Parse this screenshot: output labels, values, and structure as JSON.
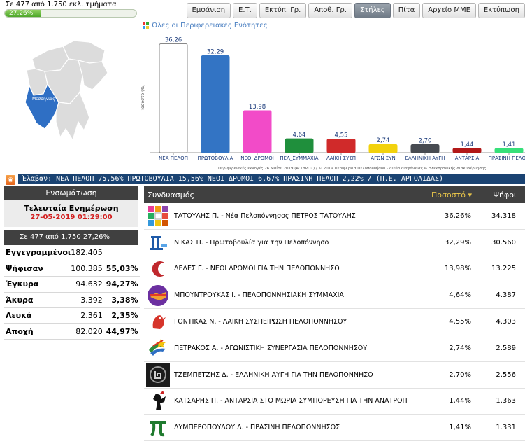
{
  "header": {
    "count_text": "Σε 477 από 1.750 εκλ. τμήματα",
    "progress_label": "27,26%",
    "progress_fraction": 0.2726
  },
  "toolbar": {
    "buttons": [
      {
        "label": "Εμφάνιση",
        "active": false
      },
      {
        "label": "Ε.Τ.",
        "active": false
      },
      {
        "label": "Εκτύπ. Γρ.",
        "active": false
      },
      {
        "label": "Αποθ. Γρ.",
        "active": false
      },
      {
        "label": "Στήλες",
        "active": true
      },
      {
        "label": "Πίτα",
        "active": false
      },
      {
        "label": "Αρχείο ΜΜΕ",
        "active": false
      },
      {
        "label": "Εκτύπωση",
        "active": false
      }
    ]
  },
  "map": {
    "selected_label": "Μεσσηνίας",
    "base_color": "#dcdcdc",
    "selected_color": "#2f6fc4"
  },
  "chart_title": "Όλες οι Περιφερειακές Ενότητες",
  "chart_footer": "Περιφερειακές εκλογές 26 Μαΐου 2019 (Α' ΓΥΡΟΣ) / © 2019 Περιφέρεια Πελοποννήσου - Διεύθ Διαφάνειας & Ηλεκτρονικής Διακυβέρνησης",
  "chart_data": {
    "type": "bar",
    "ylabel": "Ποσοστό (%)",
    "categories": [
      "ΝΕΑ ΠΕΛΟΠ",
      "ΠΡΩΤΟΒΟΥΛΙΑ",
      "ΝΕΟΙ ΔΡΟΜΟΙ",
      "ΠΕΛ_ΣΥΜΜΑΧΙΑ",
      "ΛΑΪΚΗ ΣΥΣΠ",
      "ΑΓΩΝ ΣΥΝ",
      "ΕΛΛΗΝΙΚΗ ΑΥΓΗ",
      "ΑΝΤΑΡΣΙΑ",
      "ΠΡΑΣΙΝΗ ΠΕΛΟΠ"
    ],
    "values": [
      36.26,
      32.29,
      13.98,
      4.64,
      4.55,
      2.74,
      2.7,
      1.44,
      1.41
    ],
    "value_labels": [
      "36,26",
      "32,29",
      "13,98",
      "4,64",
      "4,55",
      "2,74",
      "2,70",
      "1,44",
      "1,41"
    ],
    "colors": [
      "#ffffff",
      "#3374c4",
      "#f24bc8",
      "#1f8f3c",
      "#d02a2a",
      "#f2d20e",
      "#474b52",
      "#b21818",
      "#37e07a"
    ],
    "ylim": [
      0,
      38
    ]
  },
  "ticker": {
    "text": "Έλαβαν: ΝΕΑ ΠΕΛΟΠ 75,56%  ΠΡΩΤΟΒΟΥΛΙΑ 15,56%  ΝΕΟΙ ΔΡΟΜΟΙ 6,67%  ΠΡΑΣΙΝΗ ΠΕΛΟΠ 2,22%  /  (Π.Ε. ΑΡΓΟΛΙΔΑΣ)"
  },
  "left_panel": {
    "header": "Ενσωμάτωση",
    "update_title": "Τελευταία Ενημέρωση",
    "update_date": "27-05-2019 01:29:00",
    "count_text": "Σε 477  από  1.750   27,26%",
    "rows": [
      {
        "label": "Εγγεγραμμένοι",
        "value": "182.405",
        "pct": ""
      },
      {
        "label": "Ψήφισαν",
        "value": "100.385",
        "pct": "55,03%"
      },
      {
        "label": "Έγκυρα",
        "value": "94.632",
        "pct": "94,27%"
      },
      {
        "label": "Άκυρα",
        "value": "3.392",
        "pct": "3,38%"
      },
      {
        "label": "Λευκά",
        "value": "2.361",
        "pct": "2,35%"
      },
      {
        "label": "Αποχή",
        "value": "82.020",
        "pct": "44,97%"
      }
    ]
  },
  "results": {
    "header_name": "Συνδυασμός",
    "header_pct": "Ποσοστό",
    "header_votes": "Ψήφοι",
    "rows": [
      {
        "name": "ΤΑΤΟΥΛΗΣ Π. - Νέα Πελοπόννησος ΠΕΤΡΟΣ ΤΑΤΟΥΛΗΣ",
        "pct": "36,26%",
        "votes": "34.318",
        "logo": "tiles-logo"
      },
      {
        "name": "ΝΙΚΑΣ Π. - Πρωτοβουλία για την Πελοπόννησο",
        "pct": "32,29%",
        "votes": "30.560",
        "logo": "column-logo"
      },
      {
        "name": "ΔΕΔΕΣ Γ. - ΝΕΟΙ ΔΡΟΜΟΙ ΓΙΑ ΤΗΝ ΠΕΛΟΠΟΝΝΗΣΟ",
        "pct": "13,98%",
        "votes": "13.225",
        "logo": "crescent-logo"
      },
      {
        "name": "ΜΠΟΥΝΤΡΟΥΚΑΣ Ι. - ΠΕΛΟΠΟΝΝΗΣΙΑΚΗ ΣΥΜΜΑΧΙΑ",
        "pct": "4,64%",
        "votes": "4.387",
        "logo": "handshake-logo"
      },
      {
        "name": "ΓΟΝΤΙΚΑΣ Ν. - ΛΑΪΚΗ ΣΥΣΠΕΙΡΩΣΗ ΠΕΛΟΠΟΝΝΗΣΟΥ",
        "pct": "4,55%",
        "votes": "4.303",
        "logo": "rooster-logo"
      },
      {
        "name": "ΠΕΤΡΑΚΟΣ Α. - ΑΓΩΝΙΣΤΙΚΗ ΣΥΝΕΡΓΑΣΙΑ ΠΕΛΟΠΟΝΝΗΣΟΥ",
        "pct": "2,74%",
        "votes": "2.589",
        "logo": "star-logo"
      },
      {
        "name": "ΤΖΕΜΠΕΤΖΗΣ Δ. - ΕΛΛΗΝΙΚΗ ΑΥΓΗ ΓΙΑ ΤΗΝ ΠΕΛΟΠΟΝΝΗΣΟ",
        "pct": "2,70%",
        "votes": "2.556",
        "logo": "meander-logo"
      },
      {
        "name": "ΚΑΤΣΑΡΗΣ Π. - ΑΝΤΑΡΣΙΑ ΣΤΟ ΜΩΡΙΑ ΣΥΜΠΟΡΕΥΣΗ ΓΙΑ ΤΗΝ ΑΝΑΤΡΟΠ",
        "pct": "1,44%",
        "votes": "1.363",
        "logo": "figure-logo"
      },
      {
        "name": "ΛΥΜΠΕΡΟΠΟΥΛΟΥ Δ. - ΠΡΑΣΙΝΗ ΠΕΛΟΠΟΝΝΗΣΟΣ",
        "pct": "1,41%",
        "votes": "1.331",
        "logo": "pi-logo"
      }
    ]
  }
}
